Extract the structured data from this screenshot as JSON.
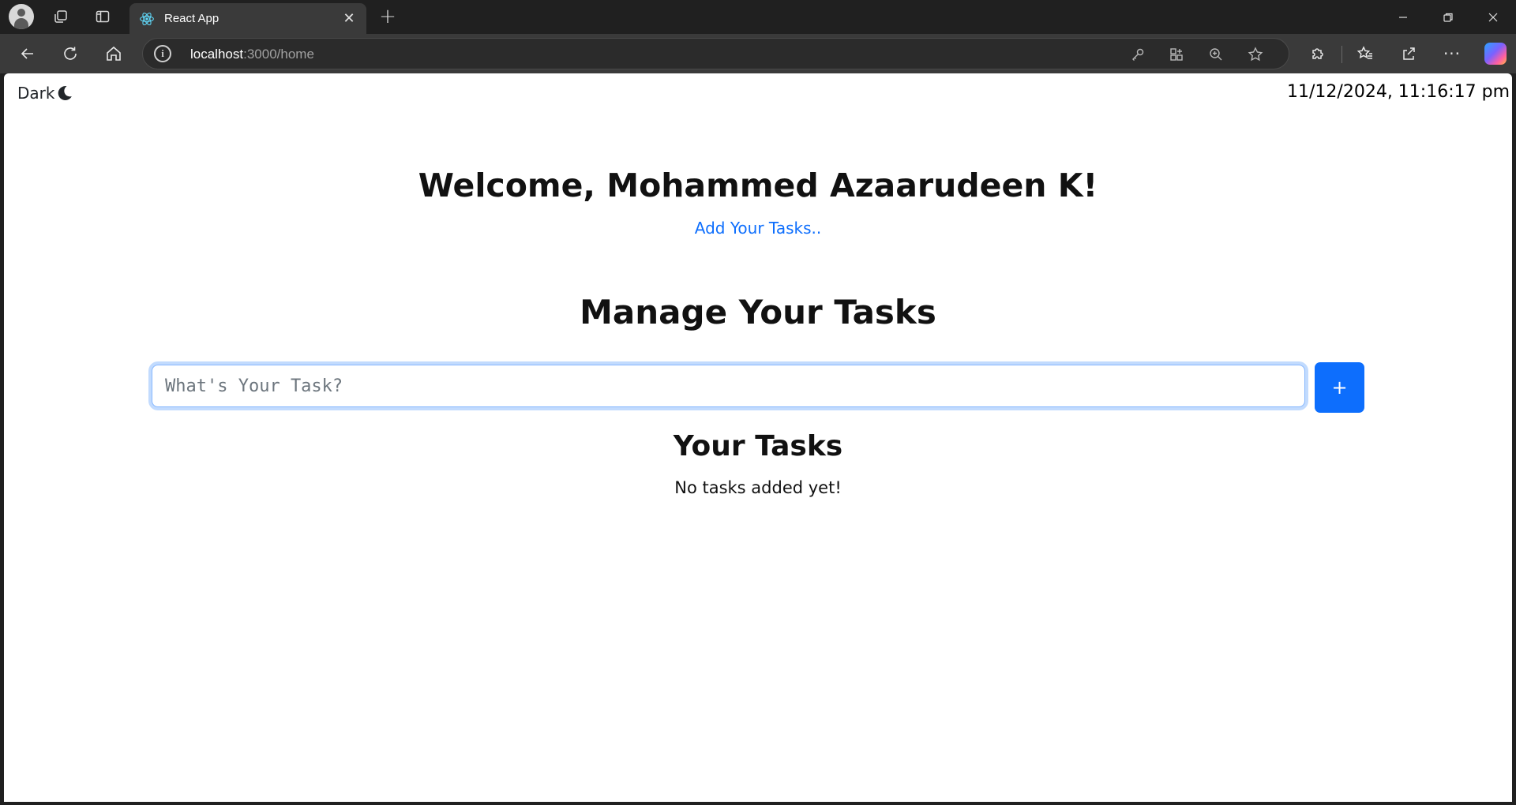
{
  "browser": {
    "tab_title": "React App",
    "address_host": "localhost",
    "address_rest": ":3000/home",
    "icons": [
      "profile-icon",
      "workspaces-icon",
      "vertical-tabs-icon",
      "react-favicon",
      "close-icon",
      "new-tab-icon",
      "minimize-icon",
      "restore-icon",
      "window-close-icon",
      "back-icon",
      "refresh-icon",
      "home-icon",
      "site-info-icon",
      "key-icon",
      "apps-icon",
      "zoom-icon",
      "favorite-star-icon",
      "extensions-icon",
      "favorites-icon",
      "share-icon",
      "more-icon",
      "copilot-icon"
    ]
  },
  "page": {
    "theme_toggle_label": "Dark",
    "datetime": "11/12/2024, 11:16:17 pm",
    "welcome": "Welcome, Mohammed Azaarudeen K!",
    "add_link": "Add Your Tasks..",
    "manage_heading": "Manage Your Tasks",
    "task_input_placeholder": "What's Your Task?",
    "task_input_value": "",
    "add_button_label": "+",
    "tasks_heading": "Your Tasks",
    "empty_message": "No tasks added yet!"
  },
  "colors": {
    "accent": "#0d6efd",
    "browser_bg": "#202020",
    "toolbar_bg": "#3a3a3a"
  }
}
